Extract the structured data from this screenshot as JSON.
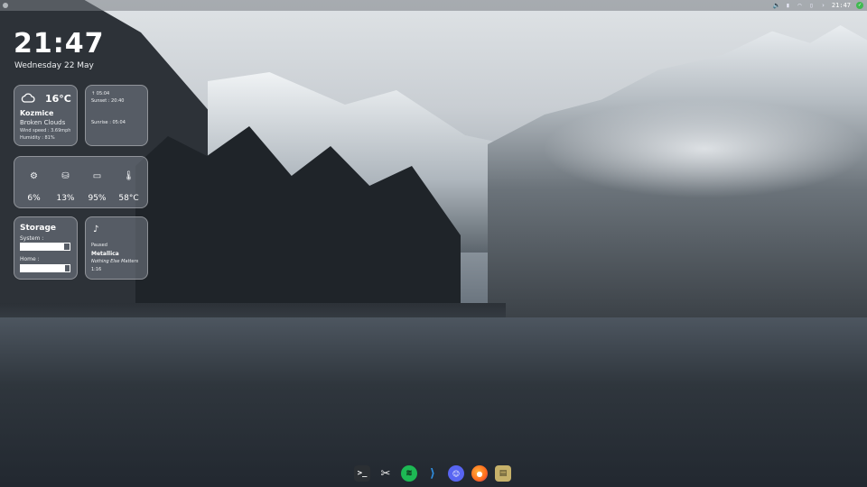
{
  "topbar": {
    "clock": "21:47",
    "icons": [
      "volume-icon",
      "clipboard-icon",
      "wifi-icon",
      "battery-icon",
      "chevron-right-icon"
    ],
    "status_dot_color": "#3fb950"
  },
  "desktop": {
    "time": "21:47",
    "date": "Wednesday 22 May"
  },
  "weather": {
    "temperature": "16°C",
    "city": "Kozmice",
    "condition": "Broken Clouds",
    "wind": "Wind speed : 3.69mph",
    "humidity": "Humidity : 81%"
  },
  "sun": {
    "line1": "↑ 05:04",
    "line2": "Sunset : 20:40",
    "line3": "Sunrise : 05:04"
  },
  "stats": [
    {
      "icon": "cpu-icon",
      "value": "6%"
    },
    {
      "icon": "database-icon",
      "value": "13%"
    },
    {
      "icon": "battery-icon",
      "value": "95%"
    },
    {
      "icon": "thermometer-icon",
      "value": "58°C"
    }
  ],
  "storage": {
    "title": "Storage",
    "system_label": "System :",
    "system_fraction": 0.88,
    "home_label": "Home :",
    "home_fraction": 0.9
  },
  "music": {
    "status": "Paused",
    "artist": "Metallica",
    "track": "Nothing Else Matters",
    "time": "1:16"
  },
  "dock": [
    {
      "name": "terminal",
      "glyph": ">_"
    },
    {
      "name": "screenshot-tool",
      "glyph": "✂"
    },
    {
      "name": "spotify",
      "glyph": "≋"
    },
    {
      "name": "vscode",
      "glyph": "⟩"
    },
    {
      "name": "discord",
      "glyph": "☺"
    },
    {
      "name": "firefox",
      "glyph": "●"
    },
    {
      "name": "file-manager",
      "glyph": "▤"
    }
  ]
}
